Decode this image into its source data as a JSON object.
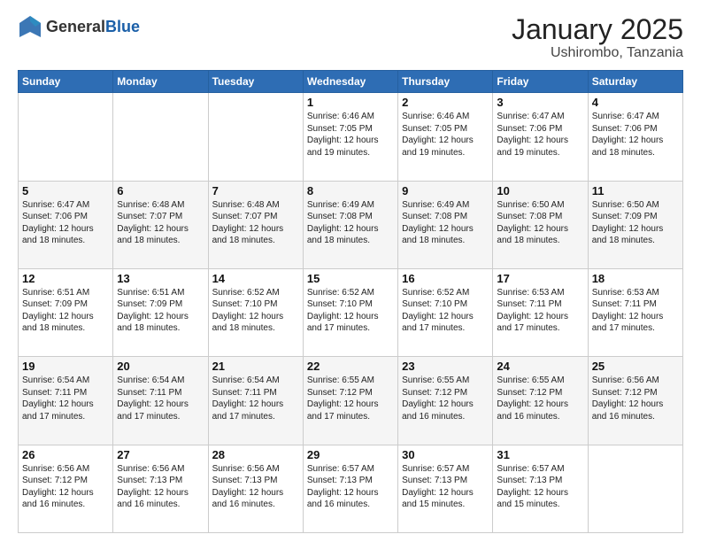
{
  "header": {
    "logo_general": "General",
    "logo_blue": "Blue",
    "month": "January 2025",
    "location": "Ushirombo, Tanzania"
  },
  "weekdays": [
    "Sunday",
    "Monday",
    "Tuesday",
    "Wednesday",
    "Thursday",
    "Friday",
    "Saturday"
  ],
  "weeks": [
    [
      {
        "day": "",
        "info": ""
      },
      {
        "day": "",
        "info": ""
      },
      {
        "day": "",
        "info": ""
      },
      {
        "day": "1",
        "info": "Sunrise: 6:46 AM\nSunset: 7:05 PM\nDaylight: 12 hours and 19 minutes."
      },
      {
        "day": "2",
        "info": "Sunrise: 6:46 AM\nSunset: 7:05 PM\nDaylight: 12 hours and 19 minutes."
      },
      {
        "day": "3",
        "info": "Sunrise: 6:47 AM\nSunset: 7:06 PM\nDaylight: 12 hours and 19 minutes."
      },
      {
        "day": "4",
        "info": "Sunrise: 6:47 AM\nSunset: 7:06 PM\nDaylight: 12 hours and 18 minutes."
      }
    ],
    [
      {
        "day": "5",
        "info": "Sunrise: 6:47 AM\nSunset: 7:06 PM\nDaylight: 12 hours and 18 minutes."
      },
      {
        "day": "6",
        "info": "Sunrise: 6:48 AM\nSunset: 7:07 PM\nDaylight: 12 hours and 18 minutes."
      },
      {
        "day": "7",
        "info": "Sunrise: 6:48 AM\nSunset: 7:07 PM\nDaylight: 12 hours and 18 minutes."
      },
      {
        "day": "8",
        "info": "Sunrise: 6:49 AM\nSunset: 7:08 PM\nDaylight: 12 hours and 18 minutes."
      },
      {
        "day": "9",
        "info": "Sunrise: 6:49 AM\nSunset: 7:08 PM\nDaylight: 12 hours and 18 minutes."
      },
      {
        "day": "10",
        "info": "Sunrise: 6:50 AM\nSunset: 7:08 PM\nDaylight: 12 hours and 18 minutes."
      },
      {
        "day": "11",
        "info": "Sunrise: 6:50 AM\nSunset: 7:09 PM\nDaylight: 12 hours and 18 minutes."
      }
    ],
    [
      {
        "day": "12",
        "info": "Sunrise: 6:51 AM\nSunset: 7:09 PM\nDaylight: 12 hours and 18 minutes."
      },
      {
        "day": "13",
        "info": "Sunrise: 6:51 AM\nSunset: 7:09 PM\nDaylight: 12 hours and 18 minutes."
      },
      {
        "day": "14",
        "info": "Sunrise: 6:52 AM\nSunset: 7:10 PM\nDaylight: 12 hours and 18 minutes."
      },
      {
        "day": "15",
        "info": "Sunrise: 6:52 AM\nSunset: 7:10 PM\nDaylight: 12 hours and 17 minutes."
      },
      {
        "day": "16",
        "info": "Sunrise: 6:52 AM\nSunset: 7:10 PM\nDaylight: 12 hours and 17 minutes."
      },
      {
        "day": "17",
        "info": "Sunrise: 6:53 AM\nSunset: 7:11 PM\nDaylight: 12 hours and 17 minutes."
      },
      {
        "day": "18",
        "info": "Sunrise: 6:53 AM\nSunset: 7:11 PM\nDaylight: 12 hours and 17 minutes."
      }
    ],
    [
      {
        "day": "19",
        "info": "Sunrise: 6:54 AM\nSunset: 7:11 PM\nDaylight: 12 hours and 17 minutes."
      },
      {
        "day": "20",
        "info": "Sunrise: 6:54 AM\nSunset: 7:11 PM\nDaylight: 12 hours and 17 minutes."
      },
      {
        "day": "21",
        "info": "Sunrise: 6:54 AM\nSunset: 7:11 PM\nDaylight: 12 hours and 17 minutes."
      },
      {
        "day": "22",
        "info": "Sunrise: 6:55 AM\nSunset: 7:12 PM\nDaylight: 12 hours and 17 minutes."
      },
      {
        "day": "23",
        "info": "Sunrise: 6:55 AM\nSunset: 7:12 PM\nDaylight: 12 hours and 16 minutes."
      },
      {
        "day": "24",
        "info": "Sunrise: 6:55 AM\nSunset: 7:12 PM\nDaylight: 12 hours and 16 minutes."
      },
      {
        "day": "25",
        "info": "Sunrise: 6:56 AM\nSunset: 7:12 PM\nDaylight: 12 hours and 16 minutes."
      }
    ],
    [
      {
        "day": "26",
        "info": "Sunrise: 6:56 AM\nSunset: 7:12 PM\nDaylight: 12 hours and 16 minutes."
      },
      {
        "day": "27",
        "info": "Sunrise: 6:56 AM\nSunset: 7:13 PM\nDaylight: 12 hours and 16 minutes."
      },
      {
        "day": "28",
        "info": "Sunrise: 6:56 AM\nSunset: 7:13 PM\nDaylight: 12 hours and 16 minutes."
      },
      {
        "day": "29",
        "info": "Sunrise: 6:57 AM\nSunset: 7:13 PM\nDaylight: 12 hours and 16 minutes."
      },
      {
        "day": "30",
        "info": "Sunrise: 6:57 AM\nSunset: 7:13 PM\nDaylight: 12 hours and 15 minutes."
      },
      {
        "day": "31",
        "info": "Sunrise: 6:57 AM\nSunset: 7:13 PM\nDaylight: 12 hours and 15 minutes."
      },
      {
        "day": "",
        "info": ""
      }
    ]
  ]
}
